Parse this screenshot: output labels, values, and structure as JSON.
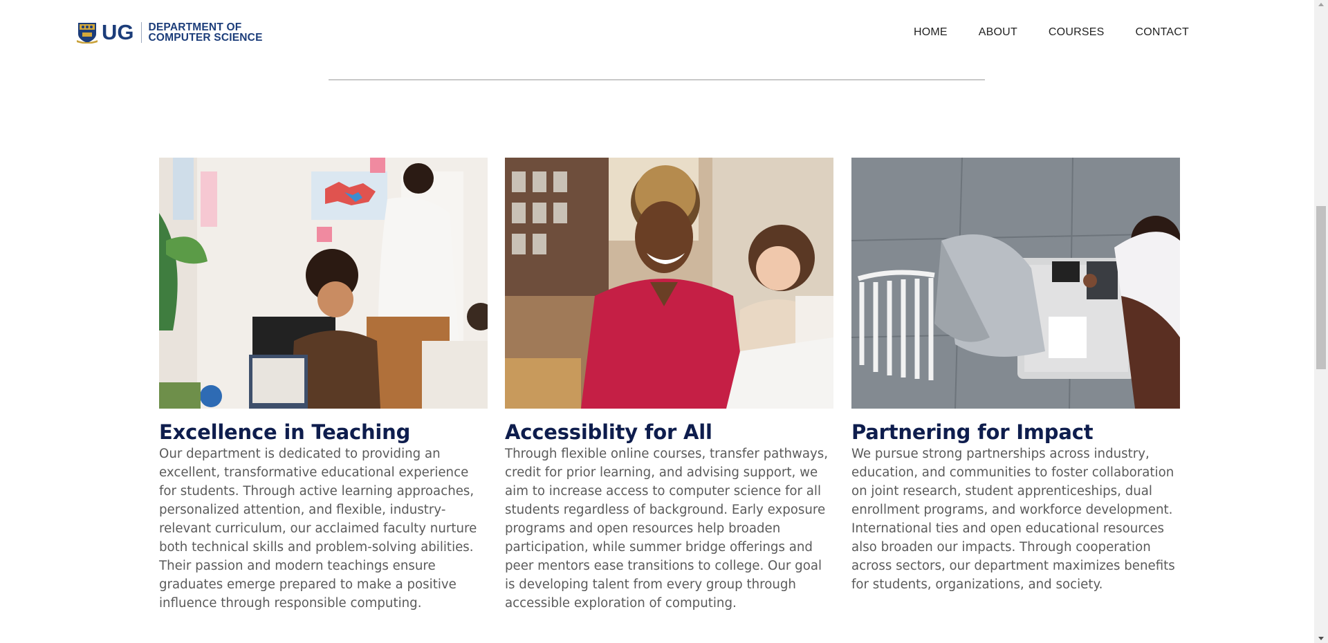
{
  "header": {
    "logo_mark": "UG",
    "logo_line1": "DEPARTMENT OF",
    "logo_line2": "COMPUTER SCIENCE",
    "nav": [
      "HOME",
      "ABOUT",
      "COURSES",
      "CONTACT"
    ]
  },
  "cards": [
    {
      "title": "Excellence in Teaching",
      "text": "Our department is dedicated to providing an excellent, transformative educational experience for students. Through active learning approaches, personalized attention, and flexible, industry-relevant curriculum, our acclaimed faculty nurture both technical skills and problem-solving abilities. Their passion and modern teachings ensure graduates emerge prepared to make a positive influence through responsible computing.",
      "image": "classroom-teaching-photo"
    },
    {
      "title": "Accessiblity for All",
      "text": "Through flexible online courses, transfer pathways, credit for prior learning, and advising support, we aim to increase access to computer science for all students regardless of background. Early exposure programs and open resources help broaden participation, while summer bridge offerings and peer mentors ease transitions to college. Our goal is developing talent from every group through accessible exploration of computing.",
      "image": "smiling-student-photo"
    },
    {
      "title": "Partnering for Impact",
      "text": "We pursue strong partnerships across industry, education, and communities to foster collaboration on joint research, student apprenticeships, dual enrollment programs, and workforce development. International ties and open educational resources also broaden our impacts. Through cooperation across sectors, our department maximizes benefits for students, organizations, and society.",
      "image": "handshake-photo"
    }
  ],
  "colors": {
    "brand_navy": "#1c3d7a",
    "title_navy": "#0e1d4d",
    "body_text": "#5a5a5a"
  }
}
